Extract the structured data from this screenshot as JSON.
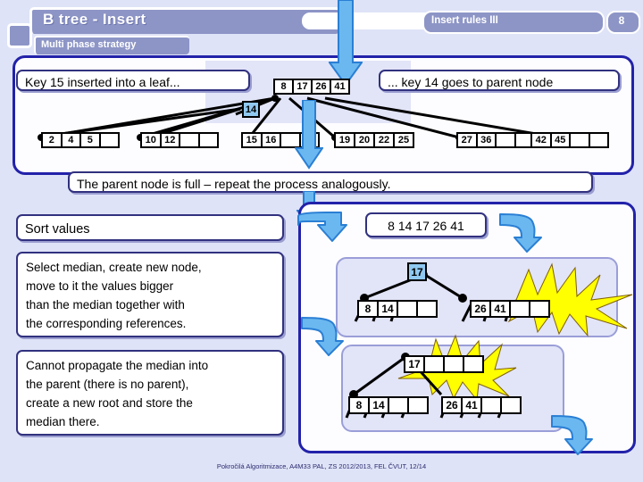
{
  "header": {
    "title": "B tree - Insert",
    "subtitle": "Multi phase strategy",
    "section": "Insert rules III",
    "slide_number": "8"
  },
  "footer": "Pokročilá Algoritmizace, A4M33 PAL, ZS 2012/2013, FEL ČVUT,  12/14",
  "callouts": {
    "left_top": "Key 15 inserted into a leaf...",
    "right_top": "... key 14 goes to parent node",
    "parent_full": "The parent node is full –  repeat the process analogously.",
    "sort_values": "Sort values",
    "select_median": "Select median, create new node,\nmove to it the values bigger\nthan the median together with\nthe corresponding  references.",
    "cannot_propagate": "Cannot propagate the median into\nthe parent (there is no parent),\ncreate a new root and store the\nmedian there.",
    "sorted_list": "8  14 17 26 41"
  },
  "tree_top": {
    "root": {
      "cells": [
        "8",
        "17",
        "26",
        "41"
      ],
      "capacity": 4
    },
    "floating_key": "14",
    "leaves": [
      {
        "cells": [
          "2",
          "4",
          "5"
        ],
        "capacity": 4
      },
      {
        "cells": [
          "10",
          "12"
        ],
        "capacity": 4
      },
      {
        "cells": [
          "15",
          "16"
        ],
        "capacity": 4
      },
      {
        "cells": [
          "19",
          "20",
          "22",
          "25"
        ],
        "capacity": 4
      },
      {
        "cells": [
          "27",
          "36"
        ],
        "capacity": 4
      },
      {
        "cells": [
          "42",
          "45"
        ],
        "capacity": 4
      }
    ]
  },
  "tree_split": {
    "median": "17",
    "left_node": {
      "cells": [
        "8",
        "14"
      ],
      "capacity": 4
    },
    "right_node": {
      "cells": [
        "26",
        "41"
      ],
      "capacity": 4
    }
  },
  "tree_newroot": {
    "root": {
      "cells": [
        "17"
      ],
      "capacity": 4
    },
    "left_node": {
      "cells": [
        "8",
        "14"
      ],
      "capacity": 4
    },
    "right_node": {
      "cells": [
        "26",
        "41"
      ],
      "capacity": 4
    }
  },
  "colors": {
    "slide_bg": "#dfe3f7",
    "header_pill": "#8d95c6",
    "panel_border": "#2222aa",
    "callout_border": "#31317f",
    "arrow_fill": "#6bb8f0",
    "arrow_stroke": "#2a7fd4",
    "highlight": "#8fc8f0",
    "starburst": "#ffff00"
  }
}
